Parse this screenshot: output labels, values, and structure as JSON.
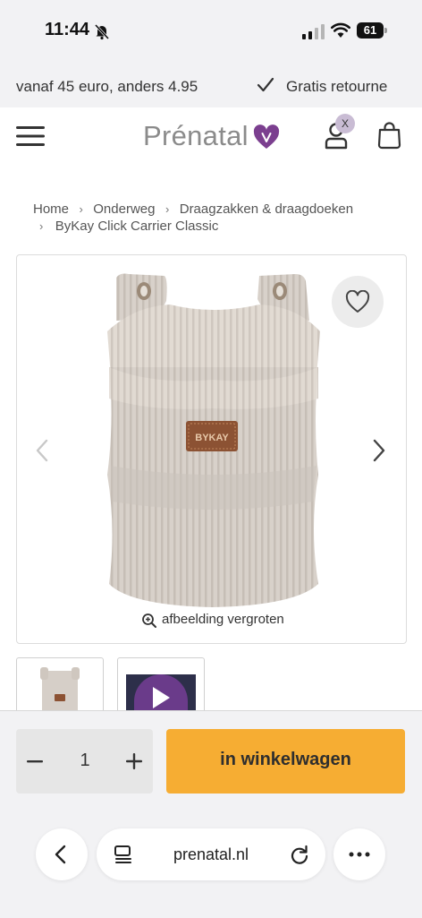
{
  "status_bar": {
    "time": "11:44",
    "battery": "61"
  },
  "promo": {
    "shipping_text": "vanaf 45 euro, anders 4.95",
    "returns_text": "Gratis retourne"
  },
  "header": {
    "logo_text": "Prénatal",
    "account_badge": "X"
  },
  "breadcrumb": {
    "items": [
      "Home",
      "Onderweg",
      "Draagzakken & draagdoeken",
      "ByKay Click Carrier Classic"
    ],
    "separator": "›"
  },
  "product": {
    "brand_tag": "BYKAY",
    "zoom_label": "afbeelding vergroten"
  },
  "purchase": {
    "quantity": "1",
    "add_to_cart_label": "in winkelwagen"
  },
  "browser": {
    "url": "prenatal.nl"
  },
  "colors": {
    "accent": "#f6ad33",
    "logo_heart": "#7b3f8f",
    "badge": "#c9bcd4"
  },
  "icons": [
    "hamburger-menu-icon",
    "account-icon",
    "shopping-bag-icon",
    "heart-icon",
    "chevron-left-icon",
    "chevron-right-icon",
    "zoom-icon",
    "play-icon",
    "minus-icon",
    "plus-icon",
    "back-icon",
    "tabs-icon",
    "reload-icon",
    "more-icon",
    "checkmark-icon",
    "signal-icon",
    "wifi-icon",
    "mute-bell-icon",
    "battery-icon"
  ]
}
